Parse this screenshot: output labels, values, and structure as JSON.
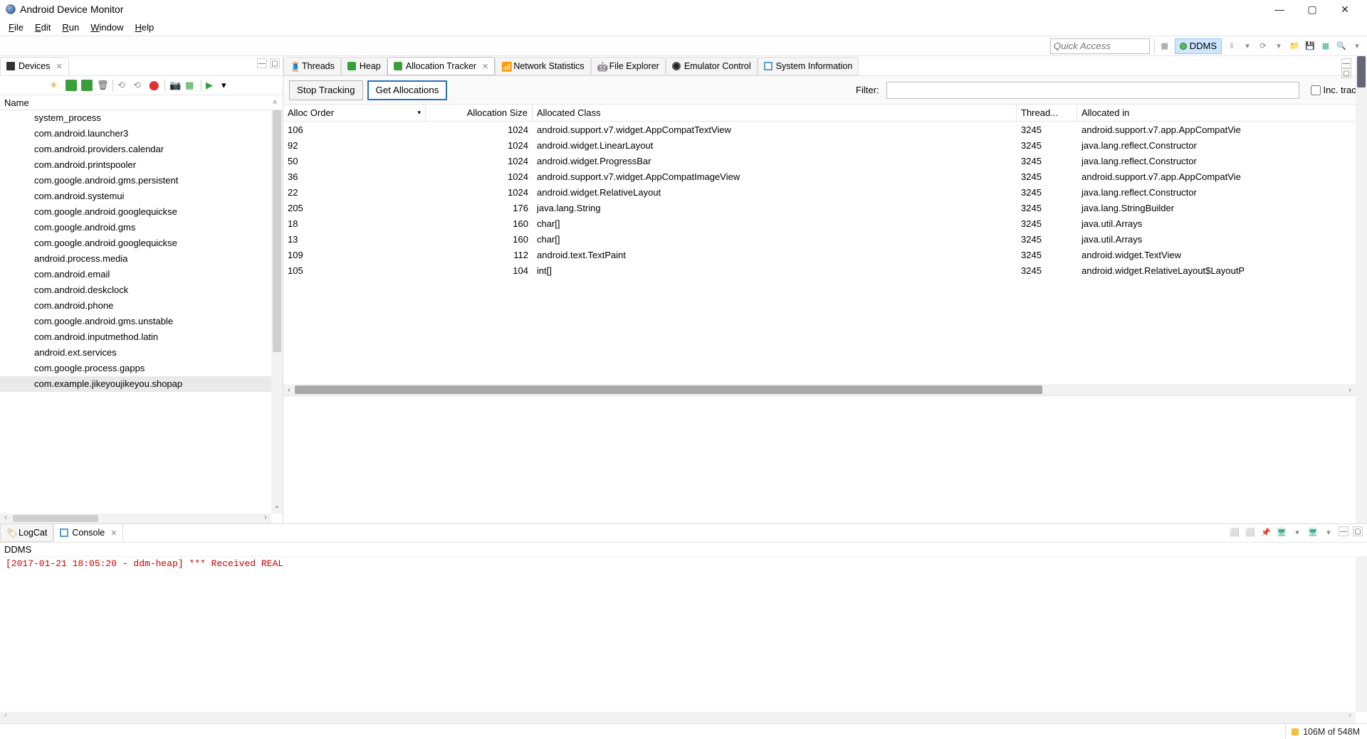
{
  "window": {
    "title": "Android Device Monitor"
  },
  "menu": {
    "file": "File",
    "edit": "Edit",
    "run": "Run",
    "window": "Window",
    "help": "Help"
  },
  "topstrip": {
    "quick_access_placeholder": "Quick Access",
    "perspective_label": "DDMS"
  },
  "devices_view": {
    "tab_label": "Devices",
    "name_header": "Name",
    "processes": [
      "system_process",
      "com.android.launcher3",
      "com.android.providers.calendar",
      "com.android.printspooler",
      "com.google.android.gms.persistent",
      "com.android.systemui",
      "com.google.android.googlequickse",
      "com.google.android.gms",
      "com.google.android.googlequickse",
      "android.process.media",
      "com.android.email",
      "com.android.deskclock",
      "com.android.phone",
      "com.google.android.gms.unstable",
      "com.android.inputmethod.latin",
      "android.ext.services",
      "com.google.process.gapps",
      "com.example.jikeyoujikeyou.shopap"
    ],
    "selected_index": 17
  },
  "right_tabs": {
    "threads": "Threads",
    "heap": "Heap",
    "allocation_tracker": "Allocation Tracker",
    "network_stats": "Network Statistics",
    "file_explorer": "File Explorer",
    "emulator_control": "Emulator Control",
    "system_info": "System Information"
  },
  "allocation_view": {
    "stop_btn": "Stop Tracking",
    "get_btn": "Get Allocations",
    "filter_label": "Filter:",
    "inc_trace_label": "Inc. trace",
    "columns": {
      "order": "Alloc Order",
      "size": "Allocation Size",
      "class": "Allocated Class",
      "thread": "Thread...",
      "in": "Allocated in"
    },
    "rows": [
      {
        "order": "106",
        "size": "1024",
        "class": "android.support.v7.widget.AppCompatTextView",
        "thread": "3245",
        "in": "android.support.v7.app.AppCompatVie"
      },
      {
        "order": "92",
        "size": "1024",
        "class": "android.widget.LinearLayout",
        "thread": "3245",
        "in": "java.lang.reflect.Constructor"
      },
      {
        "order": "50",
        "size": "1024",
        "class": "android.widget.ProgressBar",
        "thread": "3245",
        "in": "java.lang.reflect.Constructor"
      },
      {
        "order": "36",
        "size": "1024",
        "class": "android.support.v7.widget.AppCompatImageView",
        "thread": "3245",
        "in": "android.support.v7.app.AppCompatVie"
      },
      {
        "order": "22",
        "size": "1024",
        "class": "android.widget.RelativeLayout",
        "thread": "3245",
        "in": "java.lang.reflect.Constructor"
      },
      {
        "order": "205",
        "size": "176",
        "class": "java.lang.String",
        "thread": "3245",
        "in": "java.lang.StringBuilder"
      },
      {
        "order": "18",
        "size": "160",
        "class": "char[]",
        "thread": "3245",
        "in": "java.util.Arrays"
      },
      {
        "order": "13",
        "size": "160",
        "class": "char[]",
        "thread": "3245",
        "in": "java.util.Arrays"
      },
      {
        "order": "109",
        "size": "112",
        "class": "android.text.TextPaint",
        "thread": "3245",
        "in": "android.widget.TextView"
      },
      {
        "order": "105",
        "size": "104",
        "class": "int[]",
        "thread": "3245",
        "in": "android.widget.RelativeLayout$LayoutP"
      }
    ]
  },
  "bottom": {
    "logcat_tab": "LogCat",
    "console_tab": "Console",
    "console_title": "DDMS",
    "console_line": "[2017-01-21 18:05:20 - ddm-heap] *** Received REAL"
  },
  "status": {
    "memory": "106M of 548M"
  }
}
